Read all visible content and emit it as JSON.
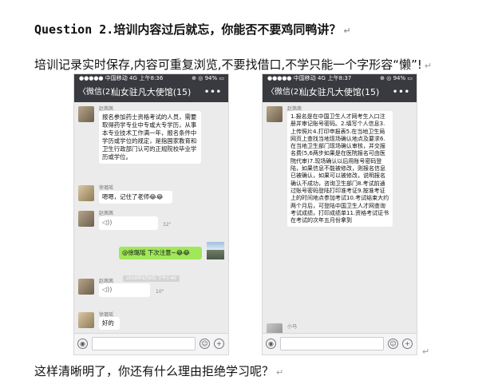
{
  "doc": {
    "question_label": "Question 2.",
    "question_text": "培训内容过后就忘，你能否不要鸡同鸭讲？",
    "para1": "培训记录实时保存,内容可重复浏览,不要找借口,不学只能一个字形容“懒”!",
    "para2": "这样清晰明了，你还有什么理由拒绝学习呢？",
    "para_mark": "↵"
  },
  "phone_left": {
    "status": {
      "carrier": "●●●●● 中国移动  4G",
      "time": "上午8:36",
      "battery": "⊕ ◎ 94% ▭"
    },
    "nav": {
      "back": "〈微信(2)",
      "title": "仙女驻凡大使馆(15)",
      "more": "•••"
    },
    "messages": {
      "sender1": "赵茜茜",
      "text1": "报名参加药士资格考试的人员，需要取得药学专业中专或大专学历，从事本专业技术工作满一年，报名条件中学历或学位的规定，是指国家教育和卫生行政部门认可的正规院校毕业学历或学位。",
      "sender2": "徐璐瑶",
      "text2": "嗯嗯，记住了老师😂😂",
      "sender3": "赵茜茜",
      "voice1_duration": "32\"",
      "text3": "@徐璐瑶 下次注意~😂😂",
      "timestamp": "2018年9月8日 下午7:40",
      "sender4": "赵茜茜",
      "voice2_duration": "10\"",
      "sender5": "徐璐瑶",
      "text4": "好的"
    }
  },
  "phone_right": {
    "status": {
      "carrier": "●●●●● 中国移动  4G",
      "time": "上午8:37",
      "battery": "⊕ ◎ 94% ▭"
    },
    "nav": {
      "back": "〈微信(2)",
      "title": "仙女驻凡大使馆(15)",
      "more": "•••"
    },
    "messages": {
      "sender1": "赵茜茜",
      "steps_text": "1.报名是在中国卫生人才网考生入口注册并审记账号密码。2.填写个人信息3.上传照片4.打印申报表5.在当地卫生局网页上查找当地现场确认地点及要求6.在当地卫生部门现场确认审核，并交报名费(5,6两步如果是在医院报名可由医院代审)7.现场确认以后用账号密码登陆，如果信息不能被修改，则报名信息已被确认，如果可以被修改，说明报名确认不成功，咨询卫生部门8.考试前通过账号密码登陆打印准考证9.按准考证上的时间地点参加考试10.考试结束大约两个月后，可登陆中国卫生人才网查询考试成绩，打印成绩单11.资格考试证书在考试的次年五月份拿到",
      "sender2": "小马"
    }
  },
  "icons": {
    "voice": "◁))",
    "voice_input": "◉",
    "emoji": "☺",
    "add": "+"
  }
}
